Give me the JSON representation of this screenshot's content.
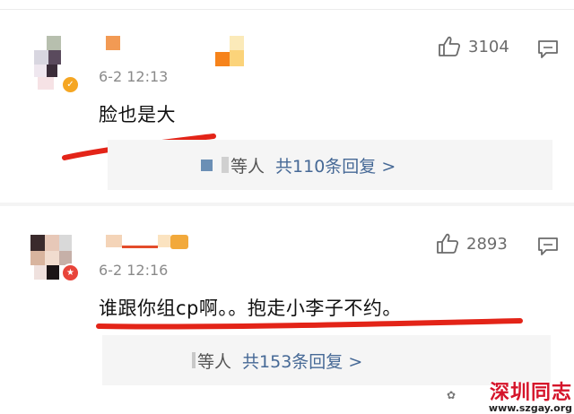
{
  "comments": [
    {
      "time": "6-2 12:13",
      "text": "脸也是大",
      "likes": "3104",
      "badge": "✓",
      "replies": {
        "who": "等人",
        "link": "共110条回复 >"
      }
    },
    {
      "time": "6-2 12:16",
      "text": "谁跟你组cp啊。。抱走小李子不约。",
      "likes": "2893",
      "badge": "★",
      "replies": {
        "who": "等人",
        "link": "共153条回复 >"
      }
    }
  ],
  "watermark": {
    "title": "深圳同志",
    "url": "www.szgay.org"
  },
  "colors": {
    "link": "#466996",
    "underline": "#e32418",
    "verified": "#f5a623",
    "badge_red": "#e8443a"
  }
}
